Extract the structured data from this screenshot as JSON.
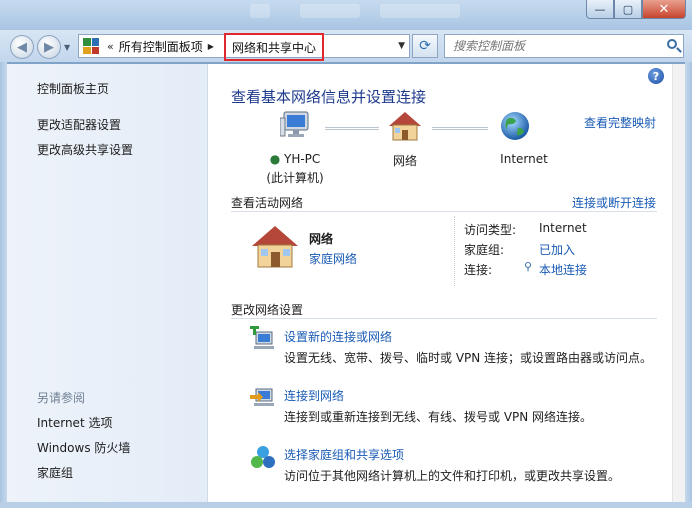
{
  "window": {
    "controls": {
      "minimize": "—",
      "maximize": "▢",
      "close": "✕"
    }
  },
  "nav": {
    "back_glyph": "◀",
    "forward_glyph": "▶",
    "breadcrumb_prefix": "«",
    "breadcrumb_parent": "所有控制面板项",
    "breadcrumb_sep": "▶",
    "breadcrumb_current": "网络和共享中心",
    "refresh_glyph": "⟳",
    "search_placeholder": "搜索控制面板"
  },
  "sidebar": {
    "top_links": [
      "控制面板主页",
      "更改适配器设置",
      "更改高级共享设置"
    ],
    "see_also_heading": "另请参阅",
    "see_also_links": [
      "Internet 选项",
      "Windows 防火墙",
      "家庭组"
    ]
  },
  "main": {
    "help_glyph": "?",
    "title": "查看基本网络信息并设置连接",
    "full_map_link": "查看完整映射",
    "map_nodes": [
      {
        "label": "YH-PC",
        "sublabel": "(此计算机)",
        "icon": "computer-icon"
      },
      {
        "label": "网络",
        "icon": "house-icon"
      },
      {
        "label": "Internet",
        "icon": "globe-icon"
      }
    ],
    "active_networks": {
      "heading": "查看活动网络",
      "connect_link": "连接或断开连接",
      "network_name": "网络",
      "network_type_link": "家庭网络",
      "details": [
        {
          "key": "访问类型:",
          "value": "Internet",
          "is_link": false
        },
        {
          "key": "家庭组:",
          "value": "已加入",
          "is_link": true
        },
        {
          "key": "连接:",
          "value": "本地连接",
          "is_link": true
        }
      ]
    },
    "change_settings": {
      "heading": "更改网络设置",
      "tasks": [
        {
          "title": "设置新的连接或网络",
          "description": "设置无线、宽带、拨号、临时或 VPN 连接；或设置路由器或访问点。",
          "icon": "new-connection-icon"
        },
        {
          "title": "连接到网络",
          "description": "连接到或重新连接到无线、有线、拨号或 VPN 网络连接。",
          "icon": "connect-network-icon"
        },
        {
          "title": "选择家庭组和共享选项",
          "description": "访问位于其他网络计算机上的文件和打印机，或更改共享设置。",
          "icon": "homegroup-icon"
        }
      ]
    }
  },
  "colors": {
    "link": "#1a5bb5",
    "title": "#1e3a8c",
    "highlight_border": "#e0282d"
  }
}
